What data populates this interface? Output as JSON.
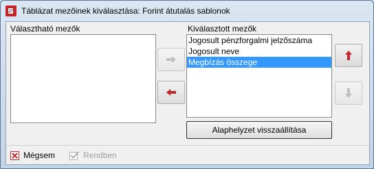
{
  "window": {
    "title": "Táblázat mezőinek kiválasztása: Forint átutalás sablonok",
    "app_icon": "app-logo-icon"
  },
  "available": {
    "label": "Választható mezők",
    "items": []
  },
  "selected": {
    "label": "Kiválasztott mezők",
    "items": [
      {
        "label": "Jogosult pénzforgalmi jelzőszáma",
        "selected": false
      },
      {
        "label": "Jogosult neve",
        "selected": false
      },
      {
        "label": "Megbízás összege",
        "selected": true
      }
    ]
  },
  "buttons": {
    "move_right": {
      "icon": "arrow-right-icon",
      "enabled": false
    },
    "move_left": {
      "icon": "arrow-left-icon",
      "enabled": true
    },
    "move_up": {
      "icon": "arrow-up-icon",
      "enabled": true
    },
    "move_down": {
      "icon": "arrow-down-icon",
      "enabled": false
    },
    "reset_label": "Alaphelyzet visszaállítása",
    "cancel_label": "Mégsem",
    "ok_label": "Rendben"
  },
  "colors": {
    "accent_red": "#c0272d",
    "selection_blue": "#3399ff",
    "disabled_gray": "#a0a0a0"
  }
}
